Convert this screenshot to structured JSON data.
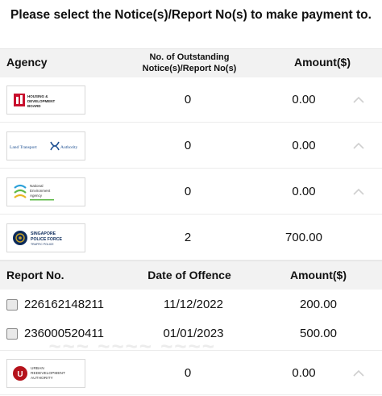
{
  "title": "Please select the Notice(s)/Report No(s) to make payment to.",
  "table_header": {
    "agency": "Agency",
    "count": "No. of Outstanding Notice(s)/Report No(s)",
    "amount": "Amount($)"
  },
  "agencies": [
    {
      "logo": "HOUSING & DEVELOPMENT BOARD",
      "count": "0",
      "amount": "0.00"
    },
    {
      "logo": "Land Transport Authority",
      "count": "0",
      "amount": "0.00"
    },
    {
      "logo": "National Environment Agency",
      "count": "0",
      "amount": "0.00"
    },
    {
      "logo": "SINGAPORE POLICE FORCE",
      "logo_sub": "TRAFFIC POLICE",
      "count": "2",
      "amount": "700.00"
    },
    {
      "logo": "URBAN REDEVELOPMENT AUTHORITY",
      "count": "0",
      "amount": "0.00"
    }
  ],
  "report_header": {
    "report_no": "Report No.",
    "date": "Date of Offence",
    "amount": "Amount($)"
  },
  "reports": [
    {
      "report_no": "226162148211",
      "date": "11/12/2022",
      "amount": "200.00",
      "checked": false
    },
    {
      "report_no": "236000520411",
      "date": "01/01/2023",
      "amount": "500.00",
      "checked": false
    }
  ],
  "colors": {
    "header_bg": "#f2f2f2",
    "hdb_red": "#c8102e",
    "lta_blue": "#1d4f91",
    "spf_navy": "#0b2a5b",
    "ura_red": "#b5121b"
  }
}
